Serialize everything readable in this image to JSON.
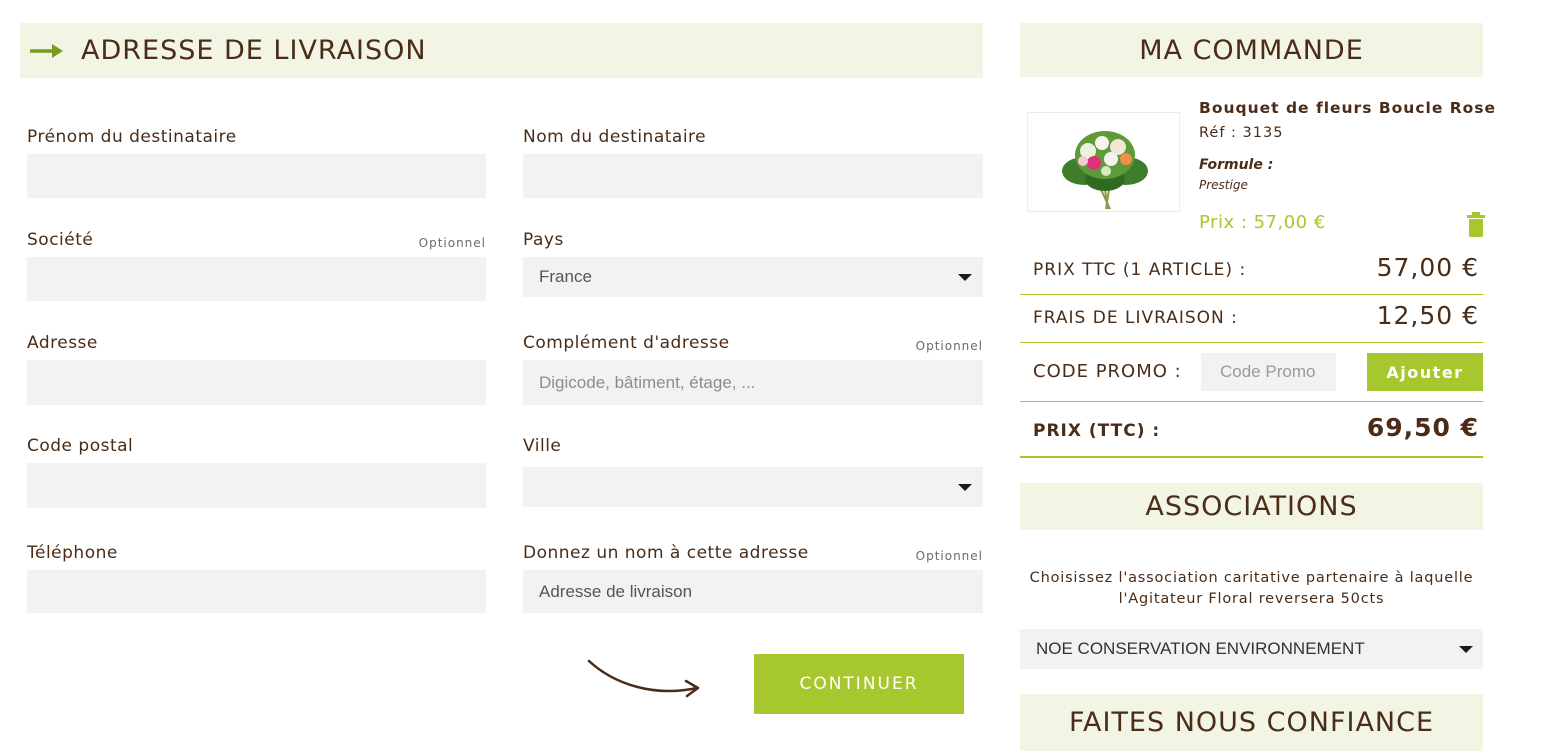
{
  "address": {
    "title": "ADRESSE DE LIVRAISON",
    "optional_label": "Optionnel",
    "fields": {
      "first_name": {
        "label": "Prénom du destinataire",
        "value": ""
      },
      "last_name": {
        "label": "Nom du destinataire",
        "value": ""
      },
      "company": {
        "label": "Société",
        "value": ""
      },
      "country": {
        "label": "Pays",
        "value": "France"
      },
      "address": {
        "label": "Adresse",
        "value": ""
      },
      "address2": {
        "label": "Complément d'adresse",
        "placeholder": "Digicode, bâtiment, étage, ..."
      },
      "postal_code": {
        "label": "Code postal",
        "value": ""
      },
      "city": {
        "label": "Ville",
        "value": ""
      },
      "phone": {
        "label": "Téléphone",
        "value": ""
      },
      "address_name": {
        "label": "Donnez un nom à cette adresse",
        "value": "Adresse de livraison"
      }
    },
    "continue_label": "CONTINUER"
  },
  "order": {
    "title": "MA COMMANDE",
    "product": {
      "name": "Bouquet de fleurs Boucle Rose",
      "ref": "Réf : 3135",
      "formule_label": "Formule :",
      "formule_value": "Prestige",
      "price": "Prix : 57,00 €"
    },
    "subtotal_label": "PRIX TTC (1 ARTICLE) :",
    "subtotal_value": "57,00 €",
    "shipping_label": "FRAIS DE LIVRAISON :",
    "shipping_value": "12,50 €",
    "promo_label": "CODE PROMO :",
    "promo_placeholder": "Code Promo",
    "promo_button": "Ajouter",
    "total_label": "PRIX (TTC) :",
    "total_value": "69,50 €"
  },
  "associations": {
    "title": "ASSOCIATIONS",
    "text": "Choisissez l'association caritative partenaire à laquelle l'Agitateur Floral reversera 50cts",
    "selected": "NOE CONSERVATION ENVIRONNEMENT"
  },
  "trust": {
    "title": "FAITES NOUS CONFIANCE"
  },
  "colors": {
    "accent": "#a6c82e",
    "text": "#4a2c17",
    "header_bg": "#f2f4e4",
    "field_bg": "#f2f2f2"
  },
  "icons": [
    "arrow-right-icon",
    "trash-icon",
    "chevron-down-icon",
    "curved-arrow-icon"
  ]
}
